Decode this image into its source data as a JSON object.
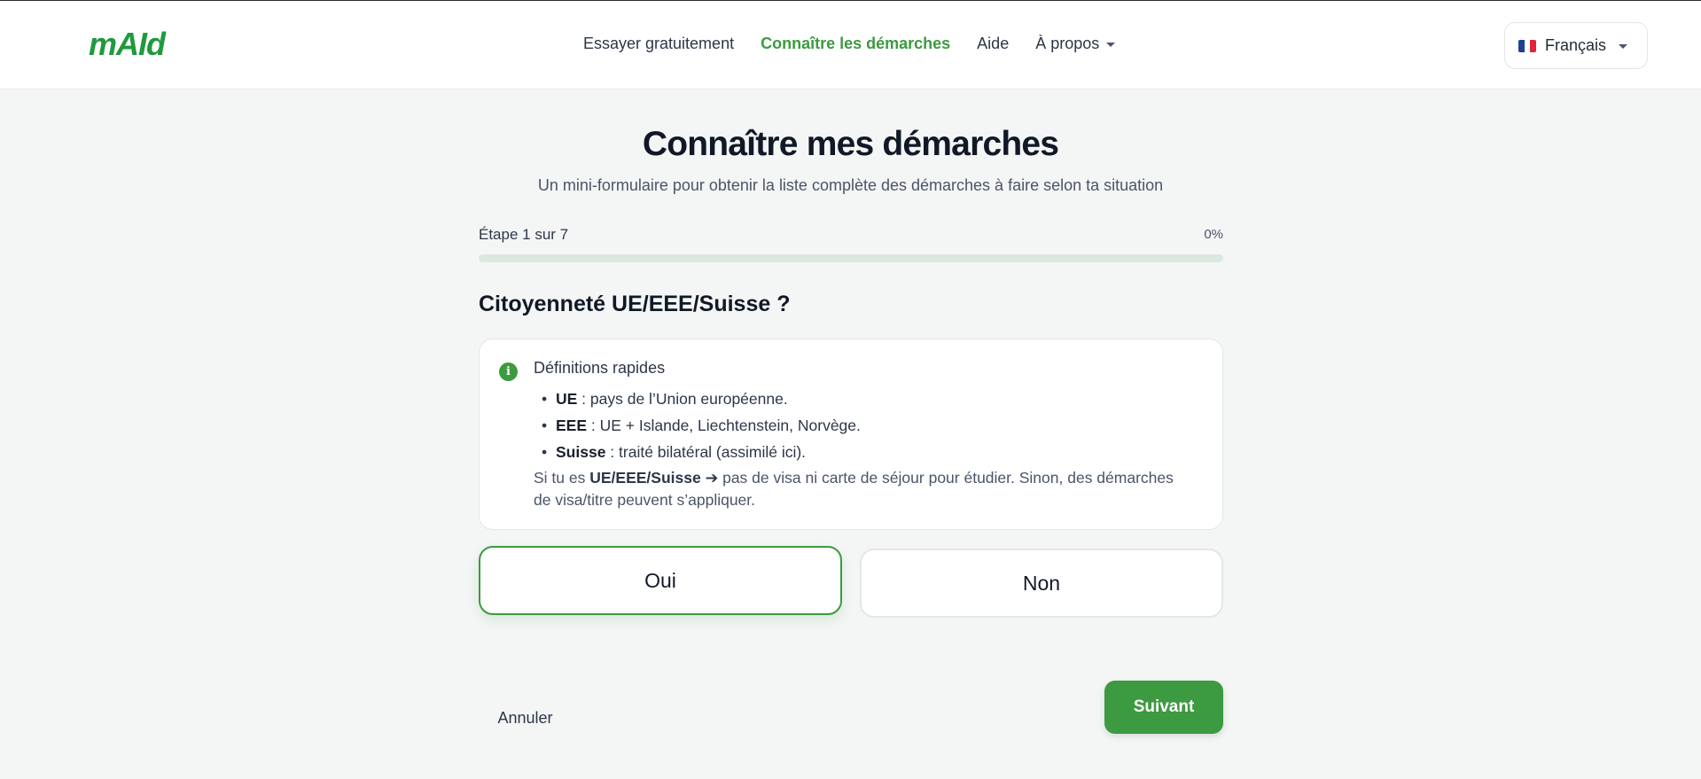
{
  "header": {
    "logo": "mAId",
    "nav": [
      {
        "label": "Essayer gratuitement",
        "active": false
      },
      {
        "label": "Connaître les démarches",
        "active": true
      },
      {
        "label": "Aide",
        "active": false
      },
      {
        "label": "À propos",
        "active": false,
        "dropdown": true
      }
    ],
    "language": {
      "label": "Français",
      "flag": "france-flag-icon"
    }
  },
  "page": {
    "title": "Connaître mes démarches",
    "subtitle": "Un mini-formulaire pour obtenir la liste complète des démarches à faire selon ta situation"
  },
  "progress": {
    "step_label": "Étape 1 sur 7",
    "percent_label": "0%",
    "value": 0
  },
  "question": {
    "title": "Citoyenneté UE/EEE/Suisse ?",
    "info": {
      "icon": "info-icon",
      "title": "Définitions rapides",
      "items": [
        {
          "term": "UE",
          "text": " : pays de l’Union européenne."
        },
        {
          "term": "EEE",
          "text": " : UE + Islande, Liechtenstein, Norvège."
        },
        {
          "term": "Suisse",
          "text": " : traité bilatéral (assimilé ici)."
        }
      ],
      "note_prefix": "Si tu es ",
      "note_bold": "UE/EEE/Suisse ➔",
      "note_suffix": " pas de visa ni carte de séjour pour étudier. Sinon, des démarches de visa/titre peuvent s’appliquer."
    },
    "options": [
      {
        "label": "Oui",
        "selected": true
      },
      {
        "label": "Non",
        "selected": false
      }
    ]
  },
  "actions": {
    "cancel_label": "Annuler",
    "next_label": "Suivant"
  },
  "colors": {
    "accent": "#3c9a40",
    "logo": "#1f9a3c",
    "background": "#f4f6f5"
  }
}
